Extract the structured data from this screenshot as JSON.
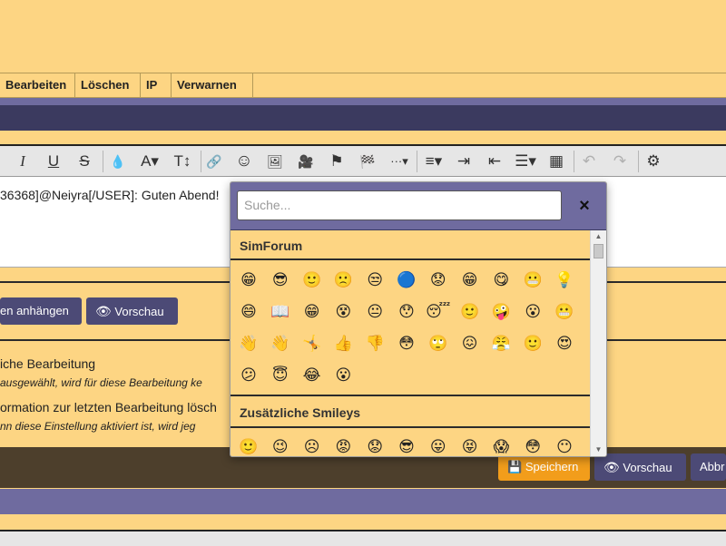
{
  "mod_bar": {
    "items": [
      "Bearbeiten",
      "Löschen",
      "IP",
      "Verwarnen"
    ]
  },
  "toolbar": {
    "buttons": [
      {
        "name": "italic-button",
        "glyph": "I"
      },
      {
        "name": "underline-button",
        "glyph": "U"
      },
      {
        "name": "strikethrough-button",
        "glyph": "S"
      },
      {
        "name": "text-color-button",
        "glyph": "💧"
      },
      {
        "name": "font-family-button",
        "glyph": "A▾"
      },
      {
        "name": "font-size-button",
        "glyph": "T↕"
      },
      {
        "name": "link-button",
        "glyph": "🔗"
      },
      {
        "name": "smilies-button",
        "glyph": "☺"
      },
      {
        "name": "image-button",
        "glyph": "🖼"
      },
      {
        "name": "video-button",
        "glyph": "🎥"
      },
      {
        "name": "flag-button",
        "glyph": "⚑"
      },
      {
        "name": "spoiler-button",
        "glyph": "🏁"
      },
      {
        "name": "more-button",
        "glyph": "···▾"
      },
      {
        "name": "align-button",
        "glyph": "≡▾"
      },
      {
        "name": "indent-button",
        "glyph": "⇥"
      },
      {
        "name": "outdent-button",
        "glyph": "⇤"
      },
      {
        "name": "list-button",
        "glyph": "☰▾"
      },
      {
        "name": "table-button",
        "glyph": "▦"
      },
      {
        "name": "undo-button",
        "glyph": "↶"
      },
      {
        "name": "redo-button",
        "glyph": "↷"
      },
      {
        "name": "settings-button",
        "glyph": "⚙"
      }
    ]
  },
  "editor": {
    "text": "36368]@Neiyra[/USER]: Guten Abend!"
  },
  "actions": {
    "attach_label": "en anhängen",
    "preview_label": "Vorschau"
  },
  "options": {
    "silent_title": "iche Bearbeitung",
    "silent_desc": "ausgewählt, wird für diese Bearbeitung ke",
    "clear_title": "ormation zur letzten Bearbeitung lösch",
    "clear_desc": "nn diese Einstellung aktiviert ist, wird jeg"
  },
  "footer_buttons": {
    "save_label": "Speichern",
    "preview_label": "Vorschau",
    "cancel_label": "Abbr"
  },
  "picker": {
    "search_placeholder": "Suche...",
    "close_glyph": "×",
    "sections": [
      {
        "title": "SimForum",
        "rows": [
          [
            "😁",
            "😎",
            "🙂",
            "🙁",
            "😒",
            "🔵",
            "😟",
            "😁",
            "😋",
            "😬",
            "💡"
          ],
          [
            "😄",
            "📖",
            "😁",
            "😵",
            "😐",
            "😯",
            "😴",
            "🙂",
            "🤪",
            "😮",
            "😬"
          ],
          [
            "👋",
            "👋",
            "🤸",
            "👍",
            "👎",
            "😳",
            "🙄",
            "😖",
            "😤",
            "🙂",
            "😍"
          ],
          [
            "😕",
            "😇",
            "😂",
            "😮"
          ]
        ]
      },
      {
        "title": "Zusätzliche Smileys",
        "rows": [
          [
            "🙂",
            "😉",
            "☹",
            "😡",
            "😟",
            "😎",
            "😛",
            "😝",
            "😱",
            "😳",
            "😶"
          ]
        ]
      }
    ]
  },
  "colors": {
    "page_bg": "#FDD583",
    "accent_purple": "#6f6b9f",
    "dark_purple": "#3b3a5f",
    "button_dark": "#4c4a76",
    "save_orange": "#F29D1B",
    "brown_bar": "#4d3f2c"
  }
}
